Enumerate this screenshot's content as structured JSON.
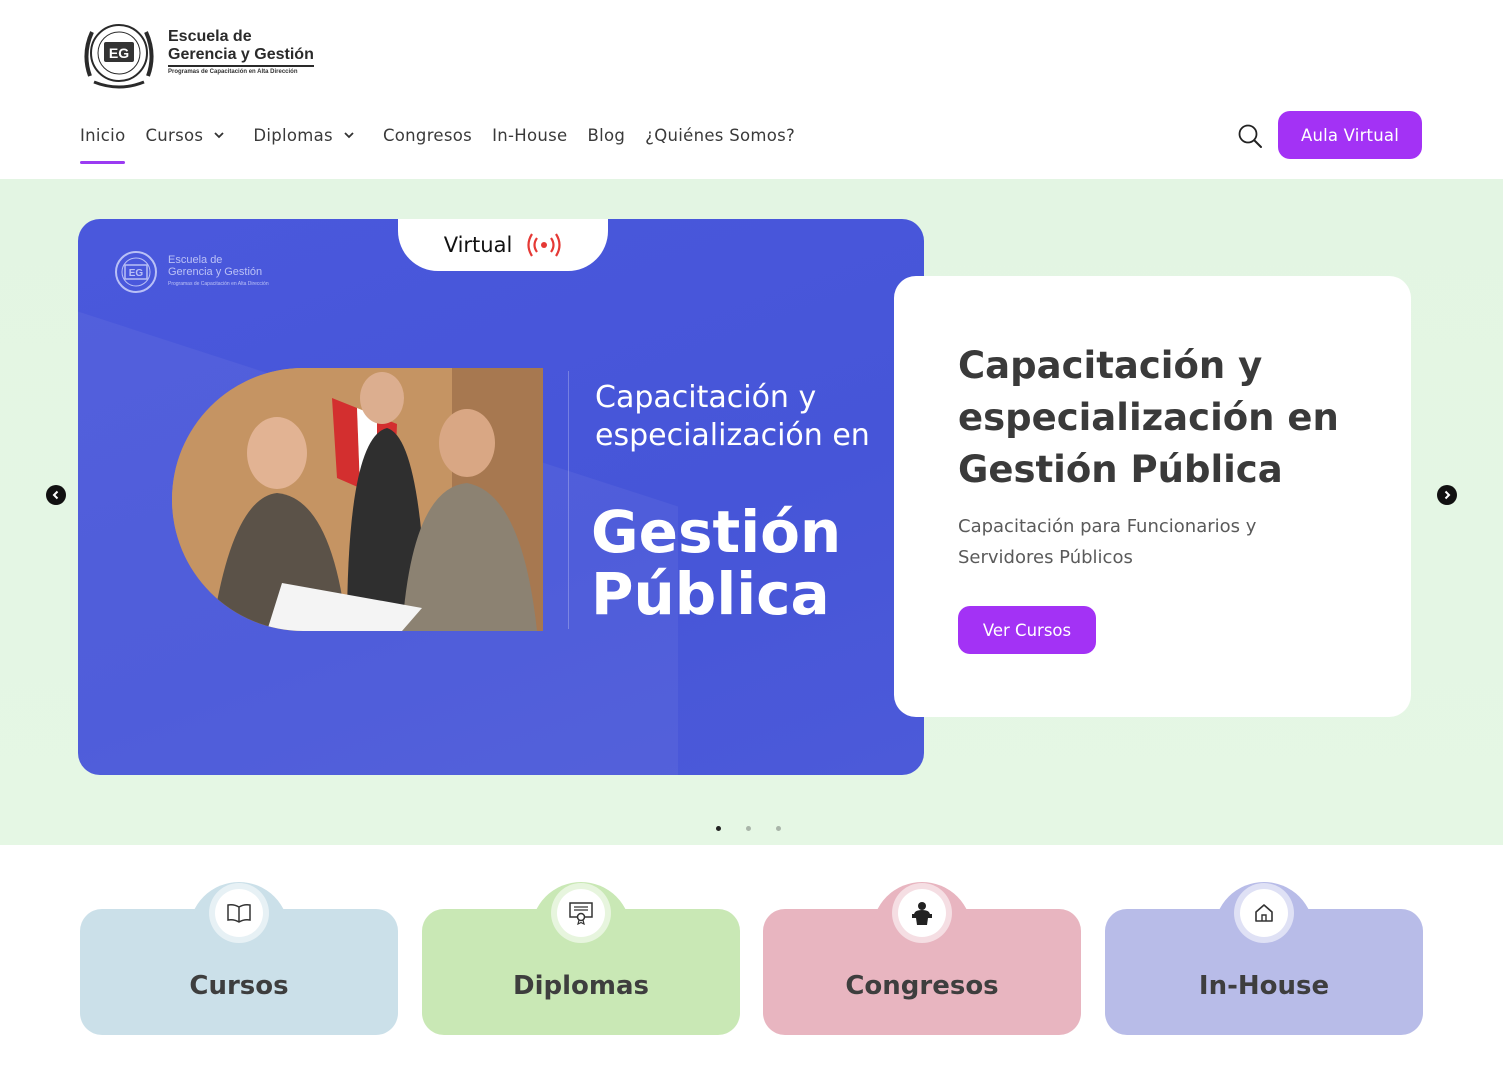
{
  "brand": {
    "seal_text": "EG",
    "line1": "Escuela de",
    "line2": "Gerencia y Gestión",
    "tagline": "Programas de Capacitación en Alta Dirección"
  },
  "nav": {
    "items": [
      {
        "label": "Inicio",
        "active": true
      },
      {
        "label": "Cursos",
        "dropdown": true
      },
      {
        "label": "Diplomas",
        "dropdown": true
      },
      {
        "label": "Congresos"
      },
      {
        "label": "In-House"
      },
      {
        "label": "Blog"
      },
      {
        "label": "¿Quiénes Somos?"
      }
    ],
    "cta": "Aula Virtual"
  },
  "hero": {
    "badge": "Virtual",
    "slide_heading": "Capacitación y especialización en",
    "slide_big": "Gestión Pública",
    "title": "Capacitación y especialización en Gestión Pública",
    "subtitle": "Capacitación para Funcionarios y Servidores Públicos",
    "button": "Ver Cursos",
    "slide_count": 3,
    "active_slide": 1
  },
  "categories": [
    {
      "label": "Cursos",
      "icon": "book-open-icon"
    },
    {
      "label": "Diplomas",
      "icon": "certificate-icon"
    },
    {
      "label": "Congresos",
      "icon": "speaker-icon"
    },
    {
      "label": "In-House",
      "icon": "home-icon"
    }
  ],
  "colors": {
    "accent": "#a332f5",
    "hero_bg": "#e3f5e3",
    "slide_blue": "#4a58dc",
    "live_red": "#e53935"
  }
}
